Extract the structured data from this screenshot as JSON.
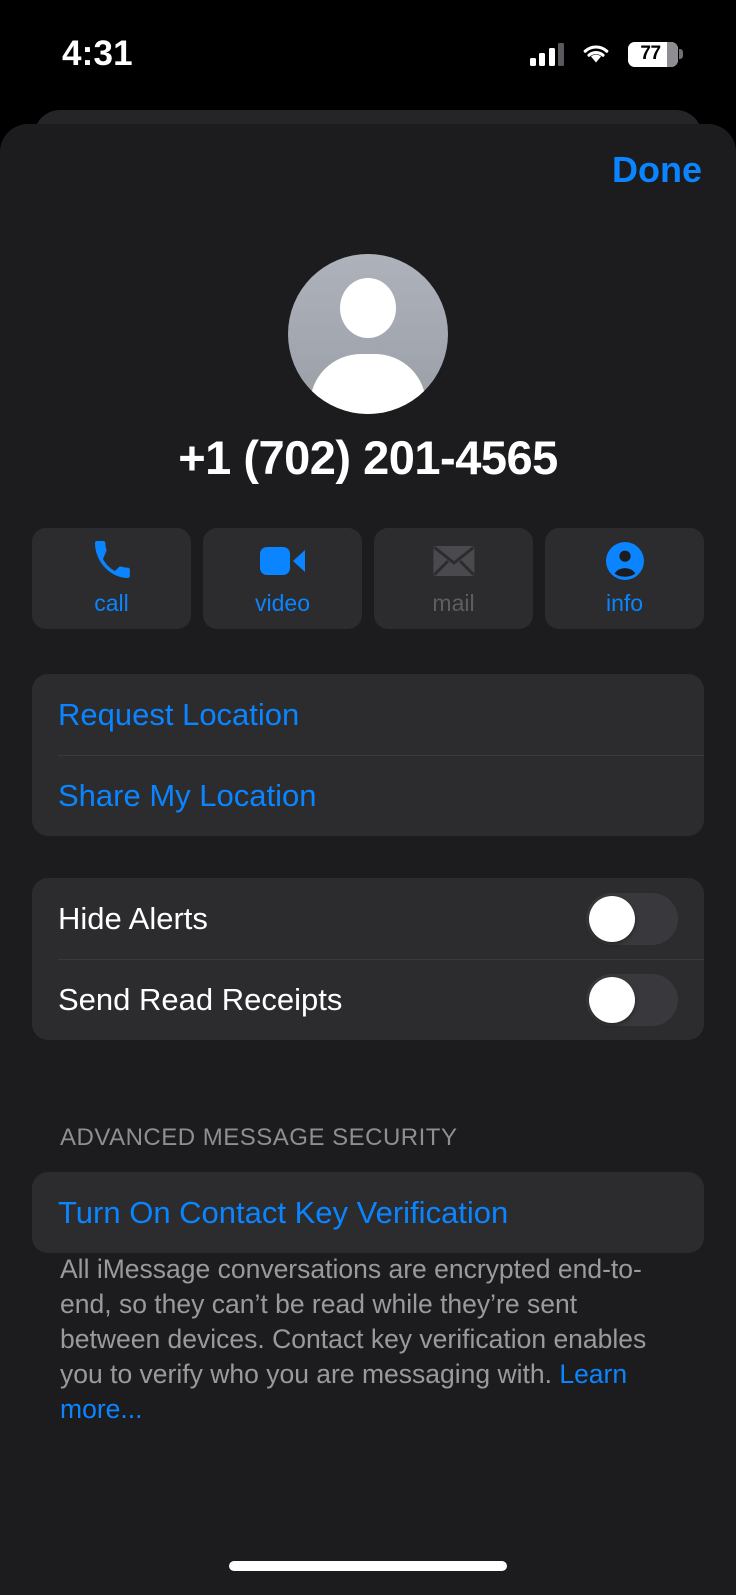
{
  "status_bar": {
    "time": "4:31",
    "battery_percent": "77",
    "signal_icon": "cellular-signal-icon",
    "wifi_icon": "wifi-icon",
    "battery_icon": "battery-icon"
  },
  "header": {
    "done_label": "Done"
  },
  "contact": {
    "avatar_icon": "default-person-avatar-icon",
    "phone_number": "+1 (702) 201-4565"
  },
  "actions": [
    {
      "label": "call",
      "icon": "phone-icon",
      "enabled": true
    },
    {
      "label": "video",
      "icon": "video-camera-icon",
      "enabled": true
    },
    {
      "label": "mail",
      "icon": "envelope-icon",
      "enabled": false
    },
    {
      "label": "info",
      "icon": "person-circle-icon",
      "enabled": true
    }
  ],
  "location_section": {
    "request_location": "Request Location",
    "share_my_location": "Share My Location"
  },
  "toggles": [
    {
      "label": "Hide Alerts",
      "value": "off"
    },
    {
      "label": "Send Read Receipts",
      "value": "off"
    }
  ],
  "security_section": {
    "header": "ADVANCED MESSAGE SECURITY",
    "action_label": "Turn On Contact Key Verification",
    "footnote_text": "All iMessage conversations are encrypted end-to-end, so they can’t be read while they’re sent between devices. Contact key verification enables you to verify who you are messaging with. ",
    "footnote_link": "Learn more..."
  },
  "colors": {
    "accent_blue": "#0a84ff",
    "sheet_background": "#1c1c1e",
    "card_background": "#2c2c2e",
    "separator": "#3a3a3c",
    "secondary_text": "#8e8e93",
    "disabled_text": "#5e5e62",
    "toggle_track_off": "#39393d"
  }
}
